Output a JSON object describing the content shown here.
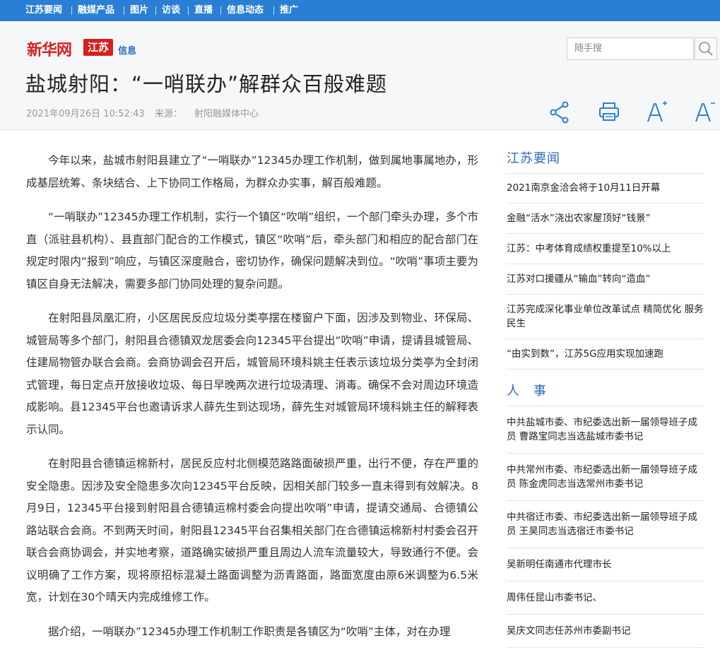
{
  "topnav": {
    "items": [
      "江苏要闻",
      "融媒产品",
      "图片",
      "访谈",
      "直播",
      "信息动态",
      "推广"
    ]
  },
  "header": {
    "logo_main": "新华网",
    "logo_badge": "江苏",
    "logo_sub": "信息",
    "search_placeholder": "随手搜"
  },
  "article": {
    "title": "盐城射阳：“一哨联办”解群众百般难题",
    "date": "2021年09月26日 10:52:43",
    "source_label": "来源：",
    "source": "射阳融媒体中心",
    "paragraphs": [
      "今年以来，盐城市射阳县建立了“一哨联办”12345办理工作机制，做到属地事属地办，形成基层统筹、条块结合、上下协同工作格局，为群众办实事，解百般难题。",
      "“一哨联办”12345办理工作机制，实行一个镇区“吹哨”组织，一个部门牵头办理，多个市直（派驻县机构）、县直部门配合的工作模式，镇区“吹哨”后，牵头部门和相应的配合部门在规定时限内“报到”响应，与镇区深度融合，密切协作，确保问题解决到位。“吹哨”事项主要为镇区自身无法解决，需要多部门协同处理的复杂问题。",
      "在射阳县凤凰汇府，小区居民反应垃圾分类亭摆在楼窗户下面，因涉及到物业、环保局、城管局等多个部门，射阳县合德镇双龙居委会向12345平台提出“吹哨”申请，提请县城管局、住建局物管办联合会商。会商协调会召开后，城管局环境科姚主任表示该垃圾分类亭为全封闭式管理，每日定点开放接收垃圾、每日早晚两次进行垃圾清理、消毒。确保不会对周边环境造成影响。县12345平台也邀请诉求人薛先生到达现场，薛先生对城管局环境科姚主任的解释表示认同。",
      "在射阳县合德镇运棉新村，居民反应村北侧模范路路面破损严重，出行不便，存在严重的安全隐患。因涉及安全隐患多次向12345平台反映，因相关部门较多一直未得到有效解决。8月9日，12345平台接到射阳县合德镇运棉村委会向提出吹哨”申请，提请交通局、合德镇公路站联合会商。不到两天时间，射阳县12345平台召集相关部门在合德镇运棉新村村委会召开联合会商协调会，并实地考察，道路确实破损严重且周边人流车流量较大，导致通行不便。会议明确了工作方案，现将原招标混凝土路面调整为沥青路面，路面宽度由原6米调整为6.5米宽，计划在30个晴天内完成维修工作。",
      "据介绍，一哨联办”12345办理工作机制工作职责是各镇区为“吹哨”主体，对在办理"
    ]
  },
  "sidebar": {
    "sections": [
      {
        "heading": "江苏要闻",
        "items": [
          "2021南京金洽会将于10月11日开幕",
          "金融“活水”浇出农家屋顶好“钱景”",
          "江苏：中考体育成绩权重提至10%以上",
          "江苏对口援疆从“输血”转向“造血”",
          "江苏完成深化事业单位改革试点 精简优化 服务民生",
          "“由实到数”，江苏5G应用实现加速跑"
        ]
      },
      {
        "heading": "人　事",
        "items": [
          "中共盐城市委、市纪委选出新一届领导班子成员 曹路宝同志当选盐城市委书记",
          "中共常州市委、市纪委选出新一届领导班子成员 陈金虎同志当选常州市委书记",
          "中共宿迁市委、市纪委选出新一届领导班子成员 王昊同志当选宿迁市委书记",
          "吴新明任南通市代理市长",
          "周伟任昆山市委书记、",
          "吴庆文同志任苏州市委副书记"
        ]
      }
    ]
  },
  "colors": {
    "nav_blue": "#2a7fd4",
    "brand_red": "#d6201f",
    "link_blue": "#2a6bc2"
  },
  "icons": [
    "search-icon",
    "share-icon",
    "print-icon",
    "font-increase-icon",
    "font-decrease-icon"
  ]
}
